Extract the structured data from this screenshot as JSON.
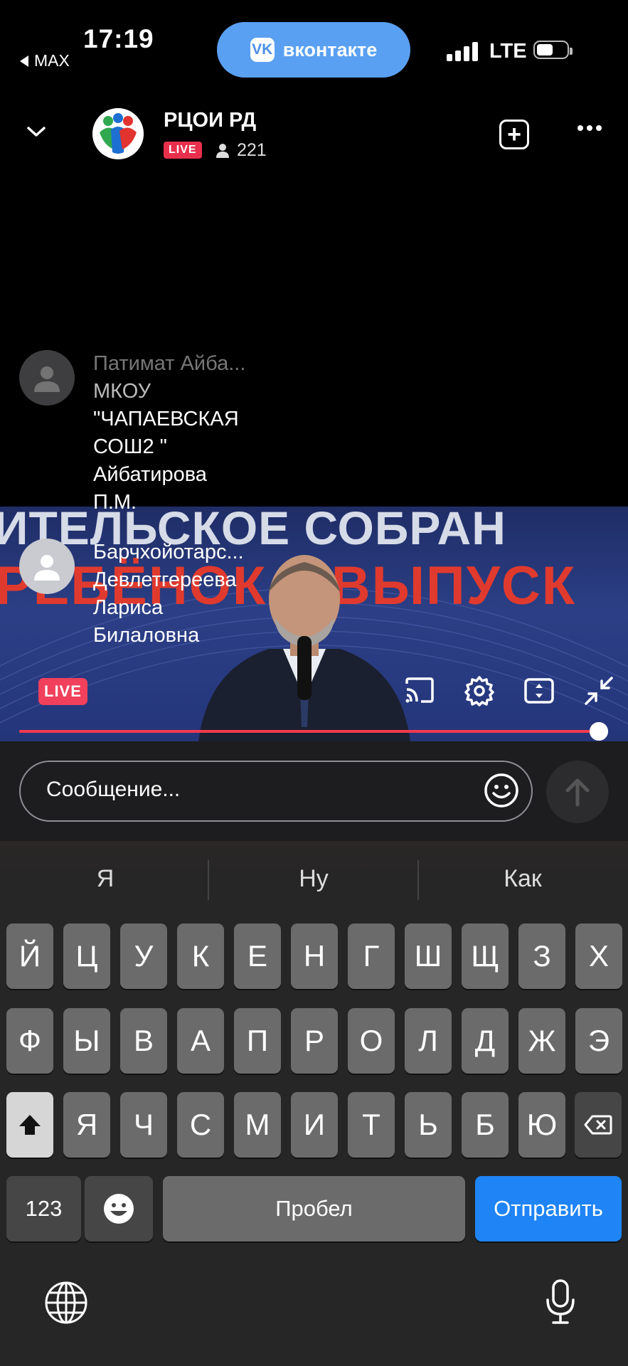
{
  "status_bar": {
    "back_app": "MAX",
    "time": "17:19",
    "app_pill": "вконтакте",
    "app_pill_logo": "VK",
    "network": "LTE"
  },
  "header": {
    "title": "РЦОИ РД",
    "live_badge": "LIVE",
    "viewers": "221"
  },
  "video": {
    "banner_line1": "ИТЕЛЬСКОЕ СОБРАН",
    "banner_line2": "РЕБЁНОК – ВЫПУСК",
    "live_badge": "LIVE"
  },
  "chat": [
    {
      "author": "Патимат Айба...",
      "lines": [
        "МКОУ",
        "\"ЧАПАЕВСКАЯ",
        "СОШ2 \"",
        "Айбатирова",
        "П.М."
      ]
    },
    {
      "author": "Барчхойотарс...",
      "lines": [
        "Девлетгереева",
        "Лариса",
        "Билаловна"
      ]
    }
  ],
  "message_input": {
    "placeholder": "Сообщение..."
  },
  "keyboard": {
    "suggestions": [
      "Я",
      "Ну",
      "Как"
    ],
    "row1": [
      "Й",
      "Ц",
      "У",
      "К",
      "Е",
      "Н",
      "Г",
      "Ш",
      "Щ",
      "З",
      "Х"
    ],
    "row2": [
      "Ф",
      "Ы",
      "В",
      "А",
      "П",
      "Р",
      "О",
      "Л",
      "Д",
      "Ж",
      "Э"
    ],
    "row3": [
      "Я",
      "Ч",
      "С",
      "М",
      "И",
      "Т",
      "Ь",
      "Б",
      "Ю"
    ],
    "numbers_key": "123",
    "space_key": "Пробел",
    "send_key": "Отправить"
  },
  "icons": [
    "back-triangle-icon",
    "vk-logo-icon",
    "signal-icon",
    "battery-icon",
    "chevron-down-icon",
    "channel-logo-icon",
    "person-icon",
    "plus-square-icon",
    "more-dots-icon",
    "cast-icon",
    "gear-icon",
    "fit-screen-icon",
    "minimize-icon",
    "smile-icon",
    "send-arrow-icon",
    "shift-icon",
    "backspace-icon",
    "emoji-icon",
    "globe-icon",
    "microphone-icon"
  ],
  "colors": {
    "live_red": "#e8304d",
    "progress_red": "#f23a4f",
    "send_blue": "#1f84f5",
    "pill_blue": "#5aa0f2"
  }
}
